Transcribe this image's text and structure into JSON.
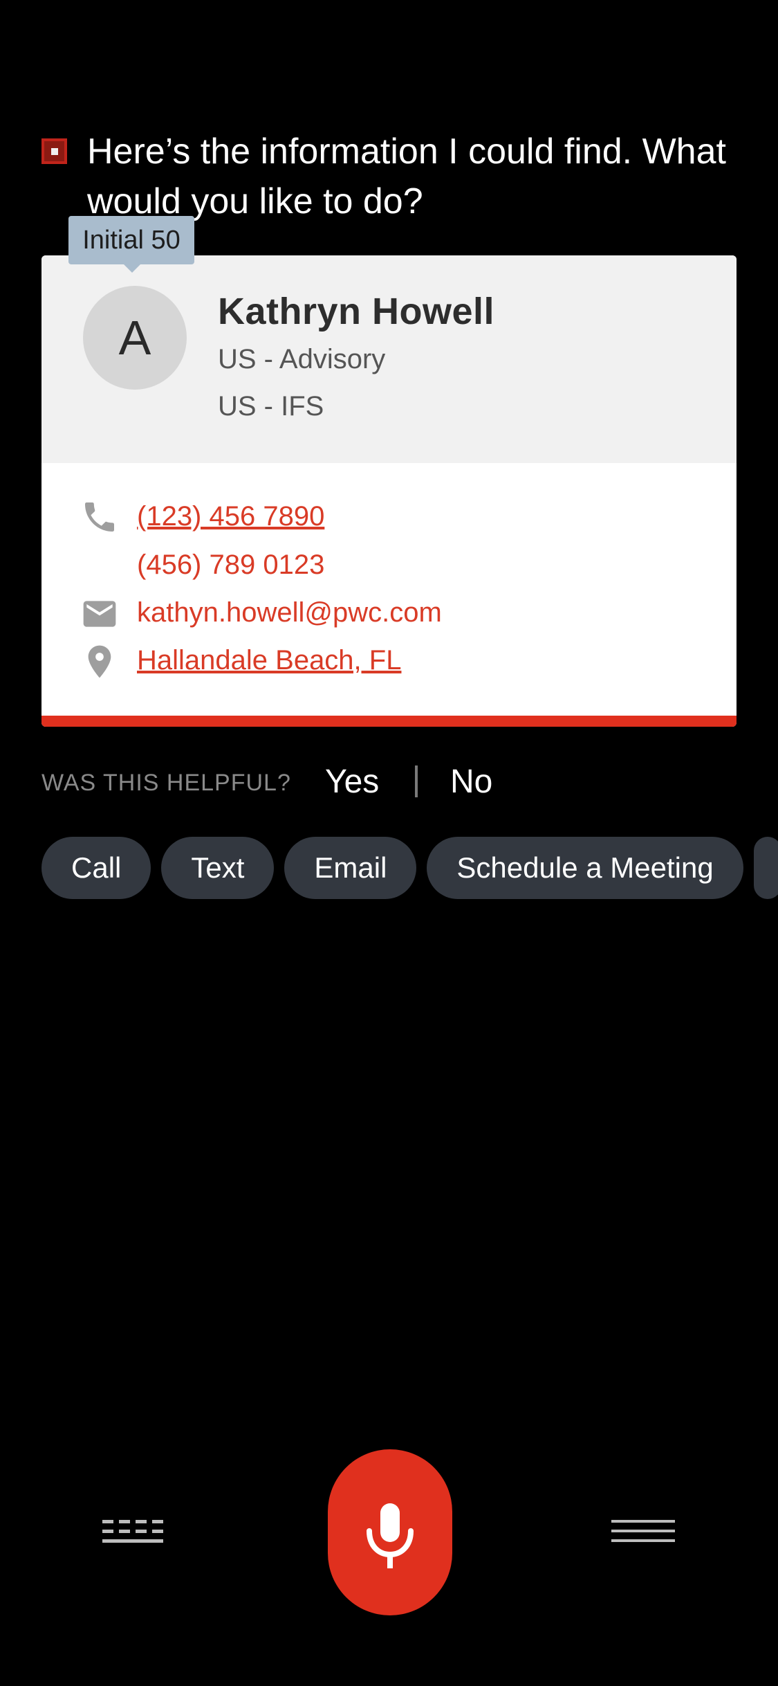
{
  "assistant": {
    "message": "Here’s the information I could find. What would you like to do?",
    "icon": "stop-square-icon",
    "accent_color": "#e0301e"
  },
  "tooltip": {
    "label": "Initial 50"
  },
  "contact": {
    "avatar_initial": "A",
    "name": "Kathryn Howell",
    "department_1": "US - Advisory",
    "department_2": "US - IFS",
    "phone_1": "(123) 456 7890",
    "phone_2": "(456) 789 0123",
    "email": "kathyn.howell@pwc.com",
    "location": "Hallandale Beach, FL",
    "icons": {
      "phone": "phone-icon",
      "email": "mail-icon",
      "location": "location-pin-icon"
    }
  },
  "feedback": {
    "question": "WAS THIS HELPFUL?",
    "yes_label": "Yes",
    "no_label": "No"
  },
  "actions": [
    {
      "label": "Call"
    },
    {
      "label": "Text"
    },
    {
      "label": "Email"
    },
    {
      "label": "Schedule a Meeting"
    }
  ],
  "bottom_bar": {
    "keyboard_icon": "keyboard-icon",
    "mic_icon": "microphone-icon",
    "menu_icon": "menu-icon"
  }
}
